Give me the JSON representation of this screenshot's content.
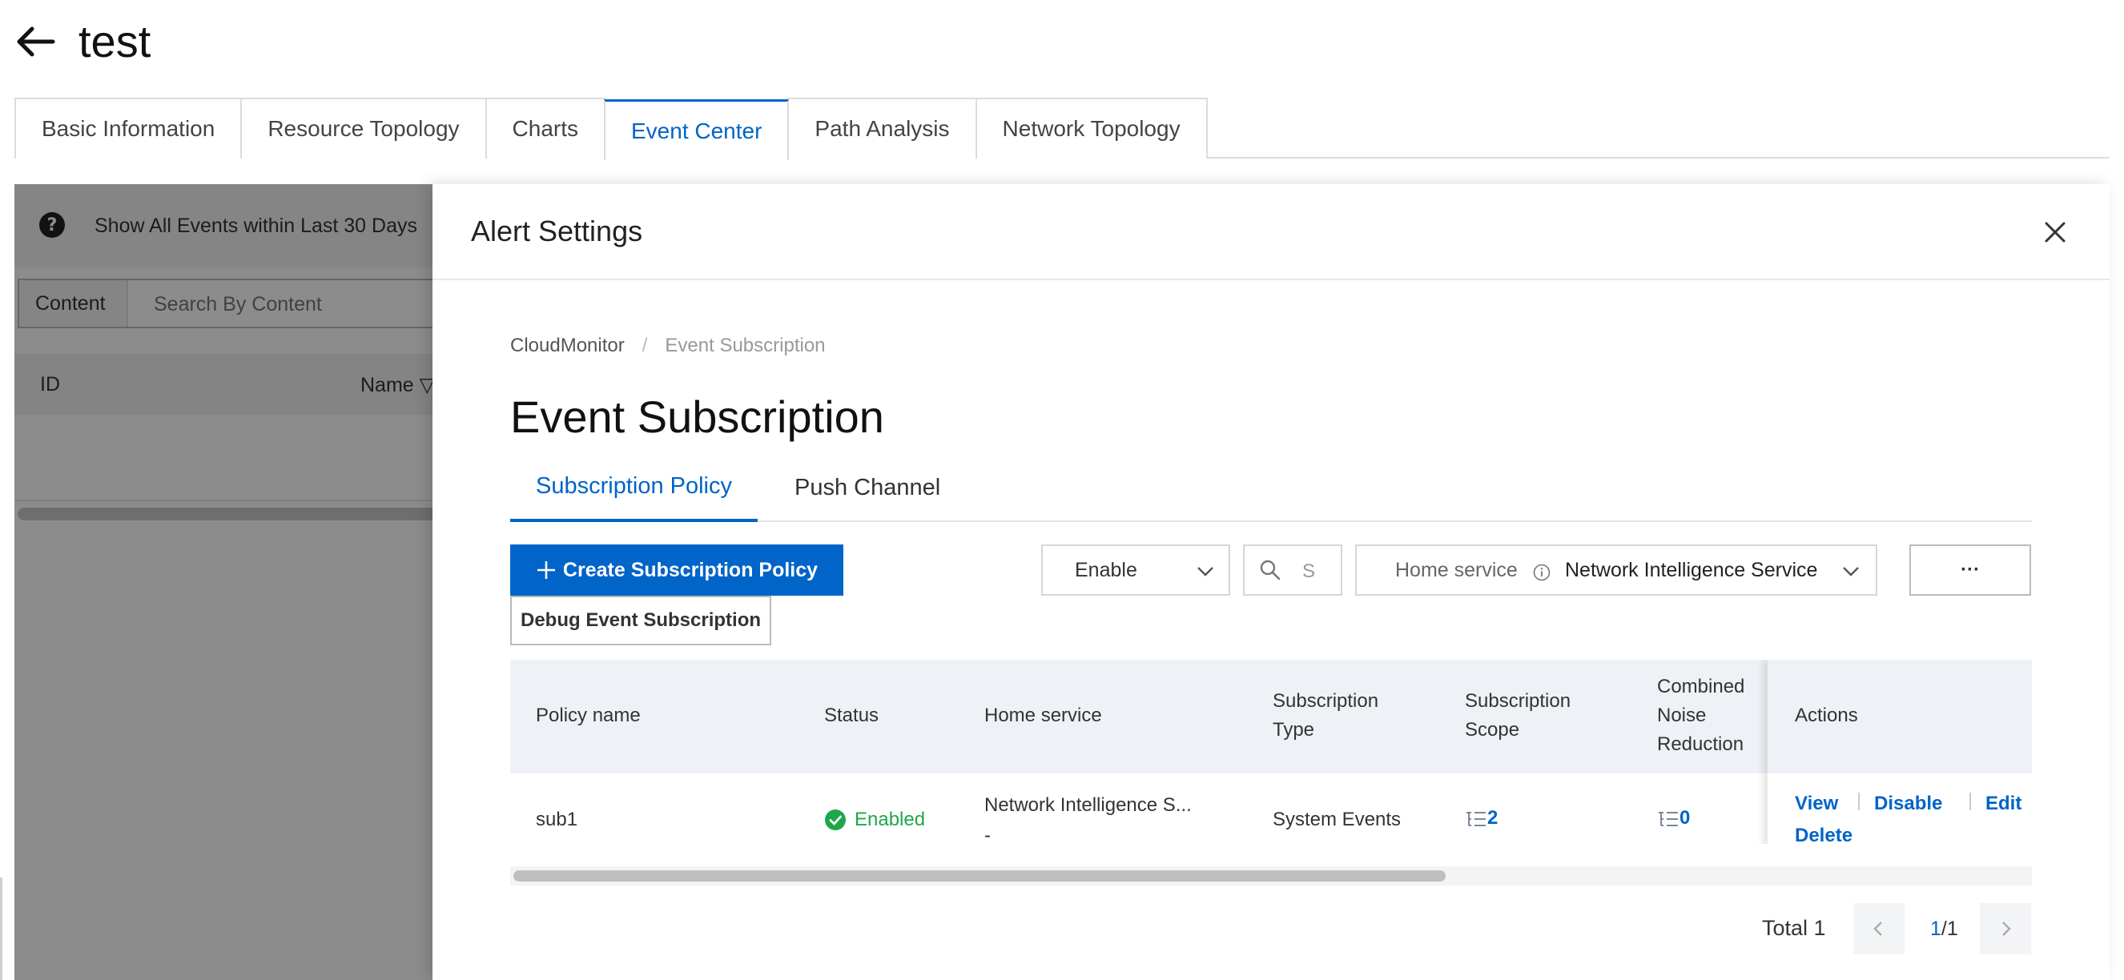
{
  "page": {
    "title": "test"
  },
  "main_tabs": [
    {
      "label": "Basic Information"
    },
    {
      "label": "Resource Topology"
    },
    {
      "label": "Charts"
    },
    {
      "label": "Event Center",
      "active": true
    },
    {
      "label": "Path Analysis"
    },
    {
      "label": "Network Topology"
    }
  ],
  "background_panel": {
    "notice": "Show All Events within Last 30 Days",
    "search_label": "Content",
    "search_placeholder": "Search By Content",
    "columns": [
      "ID",
      "Name"
    ]
  },
  "drawer": {
    "title": "Alert Settings",
    "breadcrumb": [
      "CloudMonitor",
      "/",
      "Event Subscription"
    ],
    "section_title": "Event Subscription",
    "tabs": [
      {
        "label": "Subscription Policy",
        "active": true
      },
      {
        "label": "Push Channel"
      }
    ],
    "toolbar": {
      "create_label": "Create Subscription Policy",
      "debug_label": "Debug Event Subscription",
      "status_select": "Enable",
      "search_placeholder": "S",
      "service_label": "Home service",
      "service_value": "Network Intelligence Service",
      "more_label": "···"
    },
    "table": {
      "columns": {
        "policy_name": "Policy name",
        "status": "Status",
        "home_service": "Home service",
        "sub_type_1": "Subscription",
        "sub_type_2": "Type",
        "scope_1": "Subscription",
        "scope_2": "Scope",
        "noise_1": "Combined",
        "noise_2": "Noise",
        "noise_3": "Reduction",
        "actions": "Actions"
      },
      "rows": [
        {
          "policy_name": "sub1",
          "status": "Enabled",
          "home_service": "Network Intelligence S...",
          "home_service_sub": "-",
          "subscription_type": "System Events",
          "subscription_scope": "2",
          "noise_reduction": "0",
          "actions": [
            "View",
            "Disable",
            "Edit",
            "Delete"
          ]
        }
      ]
    },
    "pagination": {
      "total": "Total 1",
      "current": "1",
      "pages": "/1"
    }
  },
  "colors": {
    "accent": "#0064c8",
    "success": "#1ea84a",
    "header_bg": "#eef1f5"
  }
}
